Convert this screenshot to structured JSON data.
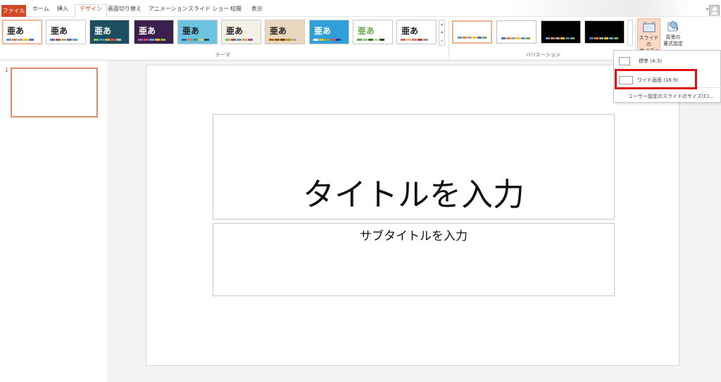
{
  "tabs": {
    "file": "ファイル",
    "home": "ホーム",
    "insert": "挿入",
    "design": "デザイン",
    "transitions": "画面切り替え",
    "animations": "アニメーション",
    "slideshow": "スライド ショー",
    "review": "校閲",
    "view": "表示"
  },
  "themes": [
    {
      "text": "亜あ",
      "bg": "#ffffff",
      "fg": "#222222",
      "bars": [
        "#5b9bd5",
        "#ed7d31",
        "#a5a5a5",
        "#ffc000",
        "#4472c4"
      ]
    },
    {
      "text": "亜あ",
      "bg": "#ffffff",
      "fg": "#222222",
      "bars": [
        "#4f81bd",
        "#c0504d",
        "#9bbb59",
        "#8064a2",
        "#4bacc6"
      ]
    },
    {
      "text": "亜あ",
      "bg": "#1d4e5f",
      "fg": "#ffffff",
      "bars": [
        "#8cc63f",
        "#2e9bd6",
        "#f2a33a",
        "#e04f4f",
        "#b8b8b8"
      ]
    },
    {
      "text": "亜あ",
      "bg": "#3b1f4d",
      "fg": "#ffffff",
      "bars": [
        "#a855c8",
        "#f03a6c",
        "#3fb5e8",
        "#f9b233",
        "#7ac143"
      ]
    },
    {
      "text": "亜あ",
      "bg": "#6cc3e0",
      "fg": "#1a1a1a",
      "bars": [
        "#1f6fb2",
        "#e76f51",
        "#2a9d8f",
        "#e9c46a",
        "#264653"
      ]
    },
    {
      "text": "亜あ",
      "bg": "#f3f1e6",
      "fg": "#222222",
      "bars": [
        "#9bbb59",
        "#c0504d",
        "#4bacc6",
        "#f79646",
        "#8064a2"
      ]
    },
    {
      "text": "亜あ",
      "bg": "#e9d8bf",
      "fg": "#222222",
      "bars": [
        "#c55a11",
        "#7f6000",
        "#833c0b",
        "#bf8f00",
        "#a5a5a5"
      ]
    },
    {
      "text": "亜あ",
      "bg": "#2f9fd7",
      "fg": "#ffffff",
      "bars": [
        "#ffffff",
        "#f2c12e",
        "#6cc04a",
        "#e84a5f",
        "#1c3f94"
      ]
    },
    {
      "text": "亜あ",
      "bg": "#ffffff",
      "fg": "#6aa84f",
      "bars": [
        "#6aa84f",
        "#93c47d",
        "#38761d",
        "#b6d7a8",
        "#274e13"
      ]
    },
    {
      "text": "亜あ",
      "bg": "#ffffff",
      "fg": "#222222",
      "bars": [
        "#e06666",
        "#f6b26b",
        "#c27ba0",
        "#cc4125",
        "#999999"
      ]
    }
  ],
  "theme_group_label": "テーマ",
  "variations": [
    {
      "bg": "#ffffff",
      "bars": [
        "#5b9bd5",
        "#ed7d31",
        "#a5a5a5",
        "#ffc000",
        "#4472c4",
        "#70ad47"
      ]
    },
    {
      "bg": "#ffffff",
      "bars": [
        "#4472c4",
        "#ed7d31",
        "#a5a5a5",
        "#ffc000",
        "#5b9bd5",
        "#70ad47"
      ]
    },
    {
      "bg": "#000000",
      "bars": [
        "#5b9bd5",
        "#ed7d31",
        "#a5a5a5",
        "#ffc000",
        "#4472c4",
        "#70ad47"
      ]
    },
    {
      "bg": "#000000",
      "bars": [
        "#4472c4",
        "#ed7d31",
        "#a5a5a5",
        "#ffc000",
        "#5b9bd5",
        "#70ad47"
      ]
    }
  ],
  "variation_group_label": "バリエーション",
  "slide_size_button": {
    "line1": "スライドの",
    "line2": "サイズ ▾"
  },
  "background_button": {
    "line1": "背景の",
    "line2": "書式設定"
  },
  "slide_size_menu": {
    "standard": "標準 (4:3)",
    "widescreen": "ワイド画面 (16:9)",
    "custom": "ユーザー設定のスライドのサイズ(C)..."
  },
  "thumbnail_number": "1",
  "slide": {
    "title_placeholder": "タイトルを入力",
    "subtitle_placeholder": "サブタイトルを入力"
  },
  "colors": {
    "accent": "#d24726",
    "highlight_box": "#e01010"
  }
}
